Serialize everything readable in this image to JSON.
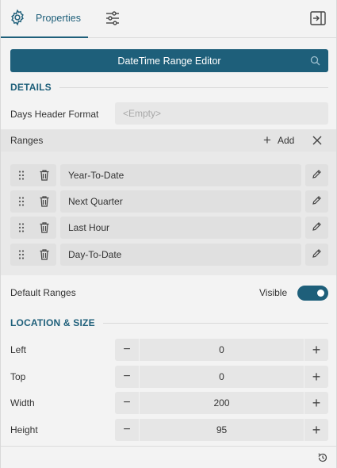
{
  "tabs": {
    "properties_label": "Properties"
  },
  "editor_button": {
    "label": "DateTime Range Editor"
  },
  "details": {
    "heading": "DETAILS",
    "days_header_format_label": "Days Header Format",
    "days_header_format_placeholder": "<Empty>"
  },
  "ranges": {
    "label": "Ranges",
    "add_label": "Add",
    "items": [
      {
        "name": "Year-To-Date"
      },
      {
        "name": "Next Quarter"
      },
      {
        "name": "Last Hour"
      },
      {
        "name": "Day-To-Date"
      }
    ]
  },
  "default_ranges": {
    "label": "Default Ranges",
    "visible_label": "Visible",
    "enabled": true
  },
  "location_size": {
    "heading": "LOCATION & SIZE",
    "fields": [
      {
        "label": "Left",
        "value": "0"
      },
      {
        "label": "Top",
        "value": "0"
      },
      {
        "label": "Width",
        "value": "200"
      },
      {
        "label": "Height",
        "value": "95"
      }
    ]
  },
  "colors": {
    "accent": "#1e5f7a",
    "panel_bg": "#f3f3f3",
    "field_bg": "#e6e6e6"
  }
}
